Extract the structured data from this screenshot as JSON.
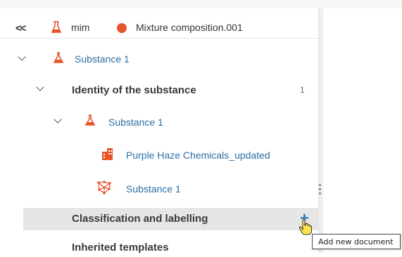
{
  "header": {
    "collapse_label": "<<",
    "user": "mim",
    "context": "Mixture composition.001"
  },
  "tree": {
    "substance": "Substance 1",
    "identity": "Identity of the substance",
    "identity_count": "1",
    "sub_substance": "Substance 1",
    "company": "Purple Haze Chemicals_updated",
    "reference": "Substance 1",
    "classification": "Classification and labelling",
    "inherited": "Inherited templates"
  },
  "tooltip": "Add new document",
  "colors": {
    "accent": "#e8552b",
    "link": "#2c6fa5",
    "plus": "#2e7bc4",
    "highlight": "#e6e6e6"
  }
}
